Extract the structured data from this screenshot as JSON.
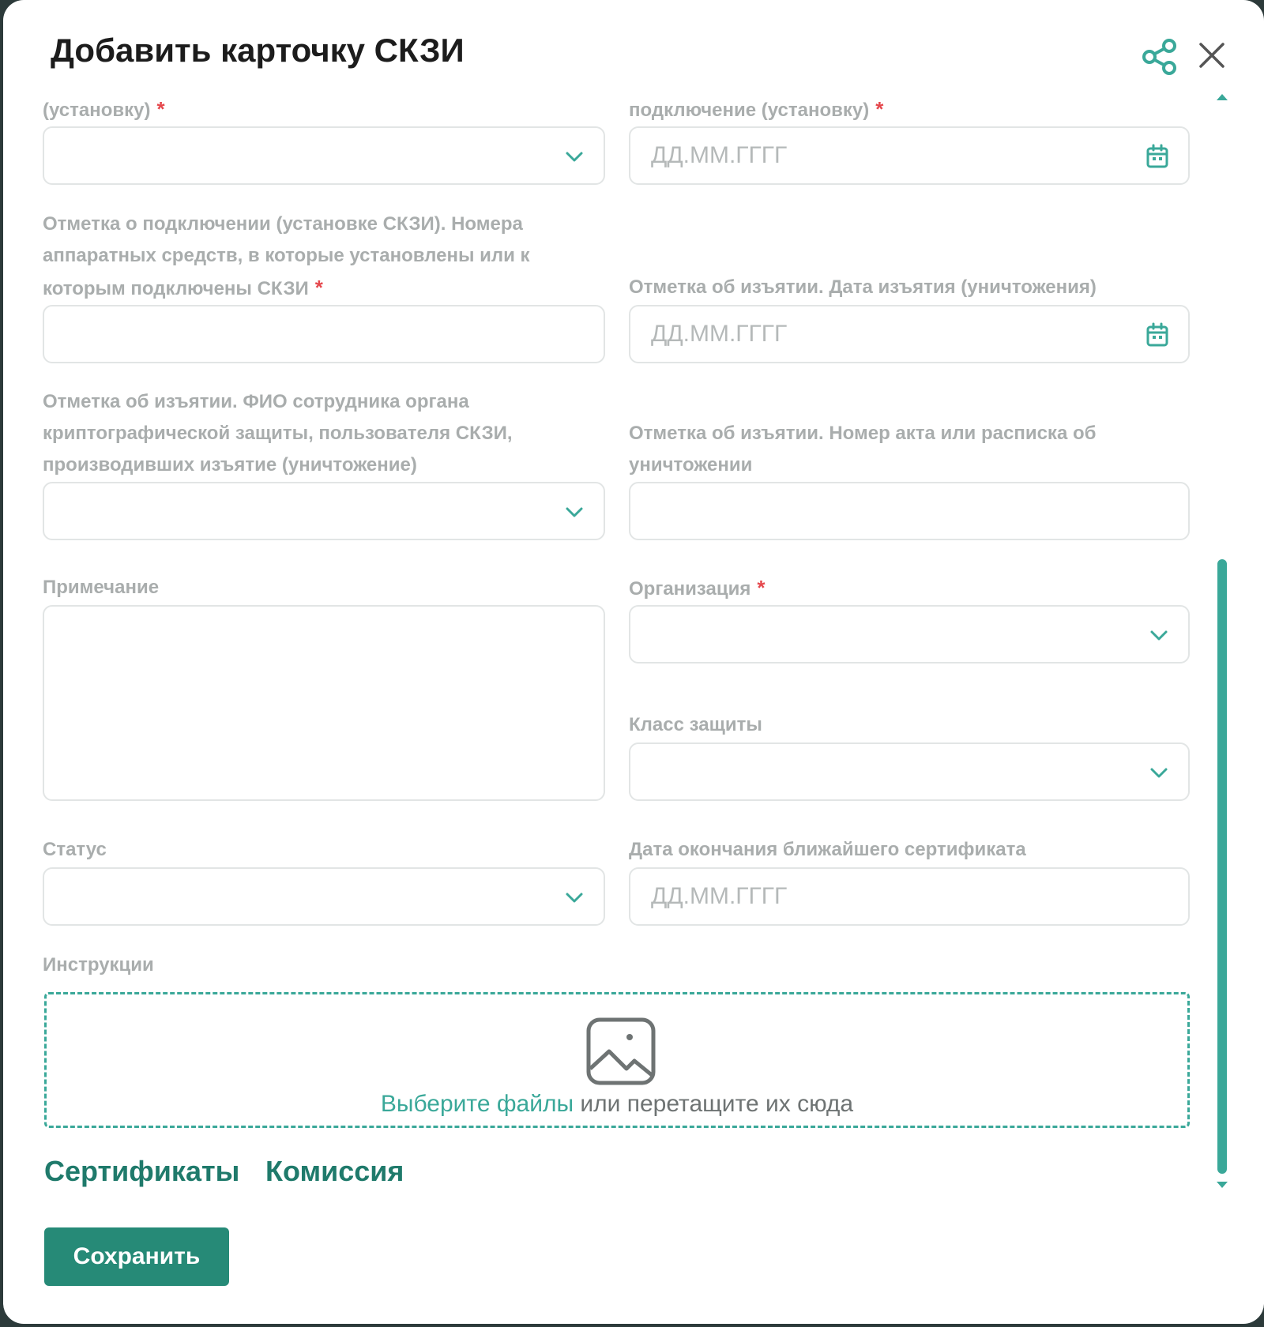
{
  "dialog": {
    "title": "Добавить карточку СКЗИ"
  },
  "form": {
    "install_by_label": "(установку)",
    "install_date_label": "подключение (установку)",
    "install_date_placeholder": "ДД.ММ.ГГГГ",
    "hw_numbers_label_line1": "Отметка о подключении (установке СКЗИ). Номера",
    "hw_numbers_label_line2": "аппаратных средств, в которые установлены или к",
    "hw_numbers_label_line3": "которым подключены СКЗИ",
    "withdraw_date_label": "Отметка об изъятии. Дата изъятия (уничтожения)",
    "withdraw_date_placeholder": "ДД.ММ.ГГГГ",
    "withdraw_person_label_line1": "Отметка об изъятии. ФИО сотрудника органа",
    "withdraw_person_label_line2": "криптографической защиты, пользователя СКЗИ,",
    "withdraw_person_label_line3": "производивших изъятие (уничтожение)",
    "withdraw_act_label_line1": "Отметка об изъятии. Номер акта или расписка об",
    "withdraw_act_label_line2": "уничтожении",
    "note_label": "Примечание",
    "organization_label": "Организация",
    "protection_class_label": "Класс защиты",
    "status_label": "Статус",
    "cert_end_date_label": "Дата окончания ближайшего сертификата",
    "cert_end_date_placeholder": "ДД.ММ.ГГГГ",
    "instructions_label": "Инструкции",
    "required_mark": "*"
  },
  "dropzone": {
    "link_text": "Выберите файлы",
    "rest_text": " или перетащите их сюда"
  },
  "tabs": [
    "Сертификаты",
    "Комиссия"
  ],
  "actions": {
    "save_label": "Сохранить"
  },
  "colors": {
    "accent": "#3aa899",
    "button": "#268a77",
    "tab_text": "#1f7a6b",
    "required": "#e5484d"
  }
}
